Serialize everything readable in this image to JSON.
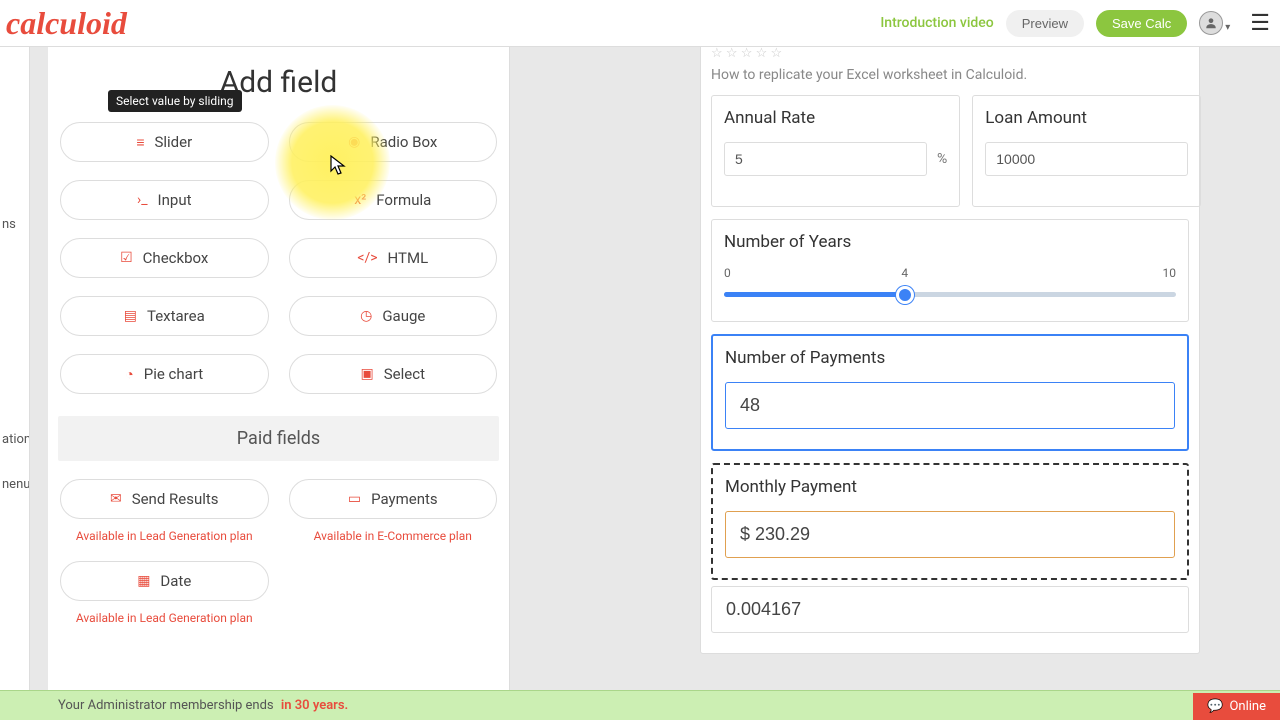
{
  "brand": "calculoid",
  "topbar": {
    "intro": "Introduction video",
    "preview": "Preview",
    "save": "Save Calc"
  },
  "left_edge": {
    "a": "ns",
    "b": "ation",
    "c": "nenu"
  },
  "add_panel": {
    "title": "Add field",
    "tooltip": "Select value by sliding",
    "fields": {
      "slider": "Slider",
      "radio": "Radio Box",
      "input": "Input",
      "formula": "Formula",
      "checkbox": "Checkbox",
      "html": "HTML",
      "textarea": "Textarea",
      "gauge": "Gauge",
      "pie": "Pie chart",
      "select": "Select"
    },
    "paid_heading": "Paid fields",
    "paid": {
      "send": "Send Results",
      "payments": "Payments",
      "date": "Date"
    },
    "avail_lead": "Available in Lead Generation plan",
    "avail_ecom": "Available in E-Commerce plan"
  },
  "calc": {
    "subtitle": "How to replicate your Excel worksheet in Calculoid.",
    "annual_rate": {
      "label": "Annual Rate",
      "value": "5",
      "suffix": "%"
    },
    "loan_amount": {
      "label": "Loan Amount",
      "value": "10000"
    },
    "years": {
      "label": "Number of Years",
      "min": "0",
      "val": "4",
      "max": "10"
    },
    "payments": {
      "label": "Number of Payments",
      "value": "48"
    },
    "monthly": {
      "label": "Monthly Payment",
      "value": "$ 230.29"
    },
    "extra": "0.004167"
  },
  "footer": {
    "text": "Your Administrator membership ends",
    "bold": "in 30 years."
  },
  "chat": "Online"
}
